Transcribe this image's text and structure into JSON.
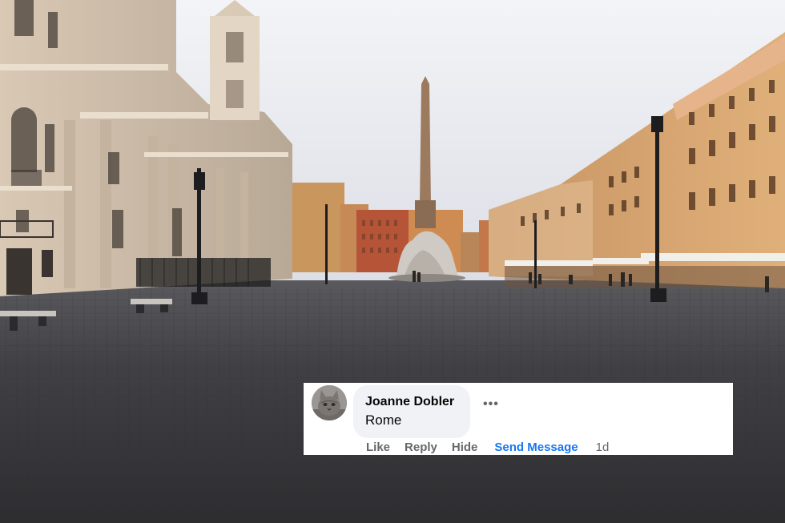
{
  "comment": {
    "author": "Joanne Dobler",
    "text": "Rome",
    "more_label": "•••",
    "avatar_icon": "cat-avatar-icon",
    "actions": {
      "like": "Like",
      "reply": "Reply",
      "hide": "Hide",
      "send_message": "Send Message"
    },
    "timestamp": "1d"
  },
  "colors": {
    "link_blue": "#1877f2",
    "meta_gray": "#65676b",
    "bubble_bg": "#f0f2f5"
  }
}
